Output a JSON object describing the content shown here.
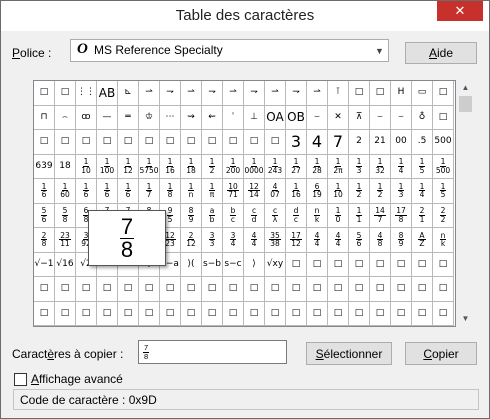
{
  "window": {
    "title": "Table des caractères",
    "close_glyph": "✕"
  },
  "font_row": {
    "label_pre": "",
    "label_ul": "P",
    "label_post": "olice :",
    "font_icon": "O",
    "selected_font": "MS Reference Specialty",
    "help_pre": "",
    "help_ul": "A",
    "help_post": "ide"
  },
  "grid": {
    "rows": [
      [
        "□",
        "□",
        "⋮⋮",
        "AB",
        "⊾",
        "⇀",
        "⇁",
        "⇀",
        "⇁",
        "⇀",
        "⇁",
        "⇀",
        "⇁",
        "⇀",
        "⊺",
        "□",
        "□",
        "H",
        "▭",
        "□"
      ],
      [
        "⊓",
        "⌢",
        "ꝏ",
        "—",
        "═",
        "♔",
        "⋯",
        "⇝",
        "⇜",
        "ˈ",
        "⊥",
        "OA",
        "OB",
        "⌣",
        "✕",
        "⊼",
        "⌣",
        "⌣",
        "♁",
        "□"
      ],
      [
        "□",
        "□",
        "□",
        "□",
        "□",
        "□",
        "□",
        "□",
        "□",
        "□",
        "□",
        "□",
        "3",
        "4",
        "7",
        "2",
        "21",
        "00",
        ".5",
        "500"
      ],
      [
        "639",
        "18",
        "1/10",
        "1/100",
        "1/12",
        "1/5750",
        "1/16",
        "1/18",
        "1/2",
        "1/200",
        "1/0000",
        "1/243",
        "1/27",
        "1/28",
        "1/2π",
        "1/3",
        "1/32",
        "1/4",
        "1/5",
        "1/500"
      ],
      [
        "1/6",
        "1/60",
        "1/6",
        "1/6",
        "1/6",
        "1/7",
        "1/8",
        "1/n",
        "1/π",
        "10/71",
        "12/14",
        "4/07",
        "1/16",
        "6/19",
        "1/10",
        "1/2",
        "1/2",
        "1/3",
        "1/4",
        "1/5"
      ],
      [
        "5/6",
        "5/8",
        "6/8",
        "7/8",
        "7/8",
        "8/7",
        "9/5",
        "8/9",
        "a/b",
        "b/c",
        "c/d",
        "c/λ",
        "d/c",
        "n/k",
        "1/0",
        "1/1",
        "14/7",
        "17/8",
        "2/1",
        "2/2"
      ],
      [
        "2/8",
        "23/11",
        "3/92",
        "3/92",
        "9/5",
        "9/23",
        "12/23",
        "2/12",
        "3/3",
        "3/4",
        "4/4",
        "35/38",
        "17/12",
        "4/4",
        "4/4",
        "5/6",
        "4/8",
        "8/9",
        "A/Z",
        "n/k"
      ],
      [
        "√−1",
        "√16",
        "√2",
        "√5",
        "√x",
        "⋮",
        "s−a",
        "⟩(",
        "s−b",
        "s−c",
        "⟩",
        "√xy",
        "□",
        "□",
        "□",
        "□",
        "□",
        "□",
        "□",
        "□"
      ],
      [
        "□",
        "□",
        "□",
        "□",
        "□",
        "□",
        "□",
        "□",
        "□",
        "□",
        "□",
        "□",
        "□",
        "□",
        "□",
        "□",
        "□",
        "□",
        "□",
        "□"
      ]
    ]
  },
  "zoom": {
    "char": "7/8"
  },
  "copy_row": {
    "label_pre": "Caract",
    "label_ul": "è",
    "label_post": "res à copier :",
    "value": "7/8",
    "select_pre": "",
    "select_ul": "S",
    "select_post": "électionner",
    "copy_pre": "",
    "copy_ul": "C",
    "copy_post": "opier"
  },
  "advanced": {
    "label_pre": "",
    "label_ul": "A",
    "label_post": "ffichage avancé",
    "checked": false
  },
  "status": {
    "text": "Code de caractère : 0x9D"
  }
}
